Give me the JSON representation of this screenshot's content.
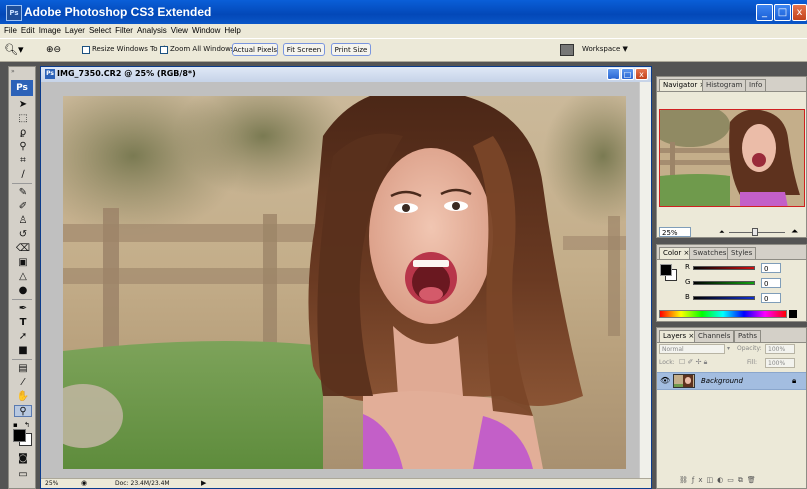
{
  "app": {
    "title": "Adobe Photoshop CS3 Extended",
    "logo_text": "Ps",
    "window_controls": {
      "minimize": "_",
      "maximize": "□",
      "close": "x"
    }
  },
  "menu": [
    "File",
    "Edit",
    "Image",
    "Layer",
    "Select",
    "Filter",
    "Analysis",
    "View",
    "Window",
    "Help"
  ],
  "options_bar": {
    "zoom_tool_icon": "magnifier-icon",
    "resize_windows_label": "Resize Windows To Fit",
    "zoom_all_windows_label": "Zoom All Windows",
    "actual_pixels_label": "Actual Pixels",
    "fit_screen_label": "Fit Screen",
    "print_size_label": "Print Size",
    "workspace_label": "Workspace"
  },
  "document": {
    "title": "IMG_7350.CR2 @ 25% (RGB/8*)",
    "zoom": "25%",
    "doc_size": "Doc: 23.4M/23.4M",
    "controls": {
      "minimize": "_",
      "maximize": "□",
      "close": "x"
    }
  },
  "navigator": {
    "tabs": [
      "Navigator",
      "Histogram",
      "Info"
    ],
    "zoom": "25%"
  },
  "color_panel": {
    "tabs": [
      "Color",
      "Swatches",
      "Styles"
    ],
    "channels": [
      {
        "label": "R",
        "value": "0",
        "color": "#d01010"
      },
      {
        "label": "G",
        "value": "0",
        "color": "#10a010"
      },
      {
        "label": "B",
        "value": "0",
        "color": "#1030d0"
      }
    ]
  },
  "layers_panel": {
    "tabs": [
      "Layers",
      "Channels",
      "Paths"
    ],
    "blend_mode": "Normal",
    "opacity_label": "Opacity:",
    "opacity_value": "100%",
    "lock_label": "Lock:",
    "fill_label": "Fill:",
    "fill_value": "100%",
    "layers": [
      {
        "name": "Background",
        "visible": true,
        "locked": true
      }
    ]
  },
  "tools": [
    "move-icon",
    "marquee-icon",
    "lasso-icon",
    "magic-wand-icon",
    "crop-icon",
    "slice-icon",
    "healing-brush-icon",
    "brush-icon",
    "clone-stamp-icon",
    "history-brush-icon",
    "eraser-icon",
    "gradient-icon",
    "blur-icon",
    "dodge-icon",
    "pen-icon",
    "type-icon",
    "path-selection-icon",
    "shape-icon",
    "notes-icon",
    "eyedropper-icon",
    "hand-icon",
    "zoom-icon"
  ],
  "colors": {
    "accent": "#0a56c8",
    "panel": "#ece9d8",
    "workspace": "#545454"
  }
}
